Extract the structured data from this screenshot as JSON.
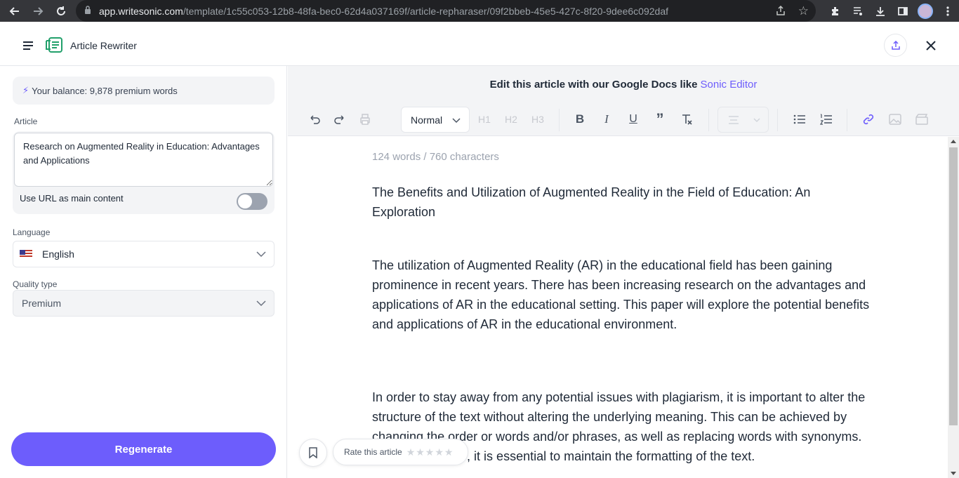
{
  "browser": {
    "url_domain": "app.writesonic.com",
    "url_path": "/template/1c55c053-12b8-48fa-bec0-62d4a037169f/article-repharaser/09f2bbeb-45e5-427c-8f20-9dee6c092daf"
  },
  "header": {
    "title": "Article Rewriter"
  },
  "left": {
    "balance": "Your balance: 9,878 premium words",
    "article_label": "Article",
    "article_value": "Research on Augmented Reality in Education: Advantages and Applications",
    "url_toggle_label": "Use URL as main content",
    "language_label": "Language",
    "language_value": "English",
    "quality_label": "Quality type",
    "quality_value": "Premium",
    "regenerate_label": "Regenerate"
  },
  "editor": {
    "banner_text": "Edit this article with our Google Docs like",
    "banner_link": "Sonic Editor",
    "format_value": "Normal",
    "h1": "H1",
    "h2": "H2",
    "h3": "H3",
    "counter": "124 words / 760 characters",
    "paragraphs": [
      "The Benefits and Utilization of Augmented Reality in the Field of Education: An Exploration",
      "The utilization of Augmented Reality (AR) in the educational field has been gaining prominence in recent years. There has been increasing research on the advantages and applications of AR in the educational setting. This paper will explore the potential benefits and applications of AR in the educational environment.",
      "In order to stay away from any potential issues with plagiarism, it is important to alter the structure of the text without altering the underlying meaning. This can be achieved by changing the order or words and/or phrases, as well as replacing words with synonyms. At the same time, it is essential to maintain the formatting of the text."
    ],
    "rate_label": "Rate this article",
    "stars": "★★★★★"
  },
  "colors": {
    "accent": "#6d5dfc",
    "chrome": "#35363a"
  }
}
